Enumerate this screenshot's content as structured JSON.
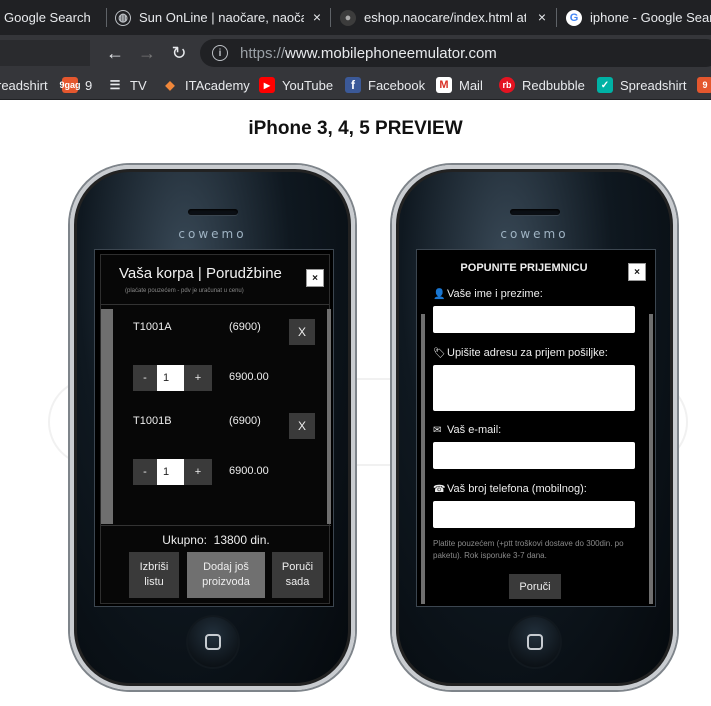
{
  "browser": {
    "tabs": [
      {
        "title": "Google Search",
        "icon": "google-icon"
      },
      {
        "title": "Sun OnLine | naočare, naočare",
        "icon": "globe-icon"
      },
      {
        "title": "eshop.naocare/index.html at m",
        "icon": "github-icon"
      },
      {
        "title": "iphone - Google Search",
        "icon": "google-icon"
      }
    ],
    "close_glyph": "×",
    "url_protocol": "https://",
    "url_host": "www.mobilephoneemulator.com",
    "bookmarks": [
      {
        "label": "readshirt",
        "icon": "spreadshirt-icon"
      },
      {
        "label": "9",
        "icon": "9gag-icon"
      },
      {
        "label": "TV",
        "icon": "tv-icon"
      },
      {
        "label": "ITAcademy",
        "icon": "itacademy-icon"
      },
      {
        "label": "YouTube",
        "icon": "youtube-icon"
      },
      {
        "label": "Facebook",
        "icon": "facebook-icon"
      },
      {
        "label": "Mail",
        "icon": "gmail-icon"
      },
      {
        "label": "Redbubble",
        "icon": "redbubble-icon"
      },
      {
        "label": "Spreadshirt",
        "icon": "spreadshirt-icon"
      }
    ]
  },
  "page": {
    "title": "iPhone 3, 4, 5 PREVIEW",
    "phone_brand": "cowemo"
  },
  "cart": {
    "title": "Vaša korpa | Porudžbine",
    "subtitle": "(plaćate pouzećem - pdv je uračunat u cenu)",
    "close": "×",
    "items": [
      {
        "code": "T1001A",
        "price": "(6900)",
        "remove": "X",
        "minus": "-",
        "qty": "1",
        "plus": "+",
        "total": "6900.00"
      },
      {
        "code": "T1001B",
        "price": "(6900)",
        "remove": "X",
        "minus": "-",
        "qty": "1",
        "plus": "+",
        "total": "6900.00"
      }
    ],
    "total_label": "Ukupno:",
    "total_value": "13800 din.",
    "btn_clear_1": "Izbriši",
    "btn_clear_2": "listu",
    "btn_add_1": "Dodaj još",
    "btn_add_2": "proizvoda",
    "btn_order_1": "Poruči",
    "btn_order_2": "sada"
  },
  "form": {
    "title": "POPUNITE PRIJEMNICU",
    "close": "×",
    "name_label": "Vaše ime i prezime:",
    "address_label": "Upišite adresu za prijem pošiljke:",
    "email_label": "Vaš e-mail:",
    "phone_label": "Vaš broj telefona (mobilnog):",
    "note": "Platite pouzećem (+ptt troškovi dostave do 300din. po paketu). Rok isporuke 3-7 dana.",
    "submit": "Poruči"
  },
  "colors": {
    "chrome_dark": "#202124",
    "chrome_toolbar": "#35363a",
    "modal_bg": "#070707",
    "button_gray": "#3a3a3a"
  }
}
